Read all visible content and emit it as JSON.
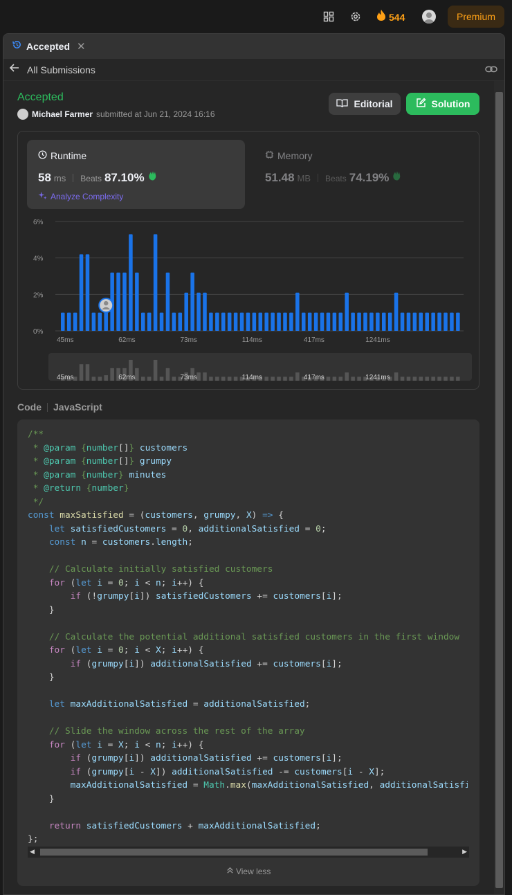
{
  "topbar": {
    "streak_count": "544",
    "premium_label": "Premium",
    "icons": [
      "layout-icon",
      "gear-icon",
      "fire-icon",
      "avatar"
    ]
  },
  "tab": {
    "label": "Accepted"
  },
  "subnav": {
    "label": "All Submissions"
  },
  "submission": {
    "status": "Accepted",
    "username": "Michael Farmer",
    "submitted_text": "submitted at Jun 21, 2024 16:16"
  },
  "buttons": {
    "editorial": "Editorial",
    "solution": "Solution"
  },
  "runtime": {
    "title": "Runtime",
    "value": "58",
    "unit": "ms",
    "beats_label": "Beats",
    "beats_value": "87.10%",
    "analyze_label": "Analyze Complexity"
  },
  "memory": {
    "title": "Memory",
    "value": "51.48",
    "unit": "MB",
    "beats_label": "Beats",
    "beats_value": "74.19%"
  },
  "colors": {
    "accent_green": "#2cbb5d",
    "bar_blue": "#1a73e8",
    "premium_orange": "#ffa116"
  },
  "chart_data": {
    "type": "bar",
    "ylim": [
      0,
      6
    ],
    "yticks": [
      "6%",
      "4%",
      "2%",
      "0%"
    ],
    "xtick_labels": [
      "45ms",
      "62ms",
      "73ms",
      "114ms",
      "417ms",
      "1241ms"
    ],
    "xtick_indices": [
      0,
      10,
      20,
      30,
      40,
      50
    ],
    "values": [
      1,
      1,
      1,
      4.2,
      4.2,
      1,
      1,
      1.4,
      3.2,
      3.2,
      3.2,
      5.3,
      3.2,
      1,
      1,
      5.3,
      1,
      3.2,
      1,
      1,
      2.1,
      3.2,
      2.1,
      2.1,
      1,
      1,
      1,
      1,
      1,
      1,
      1,
      1,
      1,
      1,
      1,
      1,
      1,
      1,
      2.1,
      1,
      1,
      1,
      1,
      1,
      1,
      1,
      2.1,
      1,
      1,
      1,
      1,
      1,
      1,
      1,
      2.1,
      1,
      1,
      1,
      1,
      1,
      1,
      1,
      1,
      1,
      1
    ],
    "highlight_index": 7,
    "grid": true
  },
  "code": {
    "header": "Code",
    "language": "JavaScript",
    "view_less": "View less",
    "lines": [
      [
        [
          "c",
          "/**"
        ]
      ],
      [
        [
          "c",
          " * "
        ],
        [
          "t",
          "@param"
        ],
        [
          "c",
          " {"
        ],
        [
          "t",
          "number"
        ],
        [
          "pl",
          "[]"
        ],
        [
          "c",
          "} "
        ],
        [
          "v",
          "customers"
        ]
      ],
      [
        [
          "c",
          " * "
        ],
        [
          "t",
          "@param"
        ],
        [
          "c",
          " {"
        ],
        [
          "t",
          "number"
        ],
        [
          "pl",
          "[]"
        ],
        [
          "c",
          "} "
        ],
        [
          "v",
          "grumpy"
        ]
      ],
      [
        [
          "c",
          " * "
        ],
        [
          "t",
          "@param"
        ],
        [
          "c",
          " {"
        ],
        [
          "t",
          "number"
        ],
        [
          "c",
          "} "
        ],
        [
          "v",
          "minutes"
        ]
      ],
      [
        [
          "c",
          " * "
        ],
        [
          "t",
          "@return"
        ],
        [
          "c",
          " {"
        ],
        [
          "t",
          "number"
        ],
        [
          "c",
          "}"
        ]
      ],
      [
        [
          "c",
          " */"
        ]
      ],
      [
        [
          "k",
          "const "
        ],
        [
          "f",
          "maxSatisfied"
        ],
        [
          "pl",
          " = ("
        ],
        [
          "v",
          "customers"
        ],
        [
          "pl",
          ", "
        ],
        [
          "v",
          "grumpy"
        ],
        [
          "pl",
          ", "
        ],
        [
          "v",
          "X"
        ],
        [
          "pl",
          ") "
        ],
        [
          "k",
          "=>"
        ],
        [
          "pl",
          " {"
        ]
      ],
      [
        [
          "pl",
          "    "
        ],
        [
          "k",
          "let "
        ],
        [
          "v",
          "satisfiedCustomers"
        ],
        [
          "pl",
          " = "
        ],
        [
          "n",
          "0"
        ],
        [
          "pl",
          ", "
        ],
        [
          "v",
          "additionalSatisfied"
        ],
        [
          "pl",
          " = "
        ],
        [
          "n",
          "0"
        ],
        [
          "pl",
          ";"
        ]
      ],
      [
        [
          "pl",
          "    "
        ],
        [
          "k",
          "const "
        ],
        [
          "v",
          "n"
        ],
        [
          "pl",
          " = "
        ],
        [
          "v",
          "customers"
        ],
        [
          "pl",
          "."
        ],
        [
          "v",
          "length"
        ],
        [
          "pl",
          ";"
        ]
      ],
      [
        [
          "pl",
          ""
        ]
      ],
      [
        [
          "pl",
          "    "
        ],
        [
          "c",
          "// Calculate initially satisfied customers"
        ]
      ],
      [
        [
          "pl",
          "    "
        ],
        [
          "ctl",
          "for"
        ],
        [
          "pl",
          " ("
        ],
        [
          "k",
          "let "
        ],
        [
          "v",
          "i"
        ],
        [
          "pl",
          " = "
        ],
        [
          "n",
          "0"
        ],
        [
          "pl",
          "; "
        ],
        [
          "v",
          "i"
        ],
        [
          "pl",
          " < "
        ],
        [
          "v",
          "n"
        ],
        [
          "pl",
          "; "
        ],
        [
          "v",
          "i"
        ],
        [
          "pl",
          "++) {"
        ]
      ],
      [
        [
          "pl",
          "        "
        ],
        [
          "ctl",
          "if"
        ],
        [
          "pl",
          " (!"
        ],
        [
          "v",
          "grumpy"
        ],
        [
          "pl",
          "["
        ],
        [
          "v",
          "i"
        ],
        [
          "pl",
          "]) "
        ],
        [
          "v",
          "satisfiedCustomers"
        ],
        [
          "pl",
          " += "
        ],
        [
          "v",
          "customers"
        ],
        [
          "pl",
          "["
        ],
        [
          "v",
          "i"
        ],
        [
          "pl",
          "];"
        ]
      ],
      [
        [
          "pl",
          "    }"
        ]
      ],
      [
        [
          "pl",
          ""
        ]
      ],
      [
        [
          "pl",
          "    "
        ],
        [
          "c",
          "// Calculate the potential additional satisfied customers in the first window"
        ]
      ],
      [
        [
          "pl",
          "    "
        ],
        [
          "ctl",
          "for"
        ],
        [
          "pl",
          " ("
        ],
        [
          "k",
          "let "
        ],
        [
          "v",
          "i"
        ],
        [
          "pl",
          " = "
        ],
        [
          "n",
          "0"
        ],
        [
          "pl",
          "; "
        ],
        [
          "v",
          "i"
        ],
        [
          "pl",
          " < "
        ],
        [
          "v",
          "X"
        ],
        [
          "pl",
          "; "
        ],
        [
          "v",
          "i"
        ],
        [
          "pl",
          "++) {"
        ]
      ],
      [
        [
          "pl",
          "        "
        ],
        [
          "ctl",
          "if"
        ],
        [
          "pl",
          " ("
        ],
        [
          "v",
          "grumpy"
        ],
        [
          "pl",
          "["
        ],
        [
          "v",
          "i"
        ],
        [
          "pl",
          "]) "
        ],
        [
          "v",
          "additionalSatisfied"
        ],
        [
          "pl",
          " += "
        ],
        [
          "v",
          "customers"
        ],
        [
          "pl",
          "["
        ],
        [
          "v",
          "i"
        ],
        [
          "pl",
          "];"
        ]
      ],
      [
        [
          "pl",
          "    }"
        ]
      ],
      [
        [
          "pl",
          ""
        ]
      ],
      [
        [
          "pl",
          "    "
        ],
        [
          "k",
          "let "
        ],
        [
          "v",
          "maxAdditionalSatisfied"
        ],
        [
          "pl",
          " = "
        ],
        [
          "v",
          "additionalSatisfied"
        ],
        [
          "pl",
          ";"
        ]
      ],
      [
        [
          "pl",
          ""
        ]
      ],
      [
        [
          "pl",
          "    "
        ],
        [
          "c",
          "// Slide the window across the rest of the array"
        ]
      ],
      [
        [
          "pl",
          "    "
        ],
        [
          "ctl",
          "for"
        ],
        [
          "pl",
          " ("
        ],
        [
          "k",
          "let "
        ],
        [
          "v",
          "i"
        ],
        [
          "pl",
          " = "
        ],
        [
          "v",
          "X"
        ],
        [
          "pl",
          "; "
        ],
        [
          "v",
          "i"
        ],
        [
          "pl",
          " < "
        ],
        [
          "v",
          "n"
        ],
        [
          "pl",
          "; "
        ],
        [
          "v",
          "i"
        ],
        [
          "pl",
          "++) {"
        ]
      ],
      [
        [
          "pl",
          "        "
        ],
        [
          "ctl",
          "if"
        ],
        [
          "pl",
          " ("
        ],
        [
          "v",
          "grumpy"
        ],
        [
          "pl",
          "["
        ],
        [
          "v",
          "i"
        ],
        [
          "pl",
          "]) "
        ],
        [
          "v",
          "additionalSatisfied"
        ],
        [
          "pl",
          " += "
        ],
        [
          "v",
          "customers"
        ],
        [
          "pl",
          "["
        ],
        [
          "v",
          "i"
        ],
        [
          "pl",
          "];"
        ]
      ],
      [
        [
          "pl",
          "        "
        ],
        [
          "ctl",
          "if"
        ],
        [
          "pl",
          " ("
        ],
        [
          "v",
          "grumpy"
        ],
        [
          "pl",
          "["
        ],
        [
          "v",
          "i"
        ],
        [
          "pl",
          " - "
        ],
        [
          "v",
          "X"
        ],
        [
          "pl",
          "]) "
        ],
        [
          "v",
          "additionalSatisfied"
        ],
        [
          "pl",
          " -= "
        ],
        [
          "v",
          "customers"
        ],
        [
          "pl",
          "["
        ],
        [
          "v",
          "i"
        ],
        [
          "pl",
          " - "
        ],
        [
          "v",
          "X"
        ],
        [
          "pl",
          "];"
        ]
      ],
      [
        [
          "pl",
          "        "
        ],
        [
          "v",
          "maxAdditionalSatisfied"
        ],
        [
          "pl",
          " = "
        ],
        [
          "t",
          "Math"
        ],
        [
          "pl",
          "."
        ],
        [
          "f",
          "max"
        ],
        [
          "pl",
          "("
        ],
        [
          "v",
          "maxAdditionalSatisfied"
        ],
        [
          "pl",
          ", "
        ],
        [
          "v",
          "additionalSatisfied"
        ],
        [
          "pl",
          ");"
        ]
      ],
      [
        [
          "pl",
          "    }"
        ]
      ],
      [
        [
          "pl",
          ""
        ]
      ],
      [
        [
          "pl",
          "    "
        ],
        [
          "ctl",
          "return "
        ],
        [
          "v",
          "satisfiedCustomers"
        ],
        [
          "pl",
          " + "
        ],
        [
          "v",
          "maxAdditionalSatisfied"
        ],
        [
          "pl",
          ";"
        ]
      ],
      [
        [
          "pl",
          "};"
        ]
      ]
    ]
  }
}
